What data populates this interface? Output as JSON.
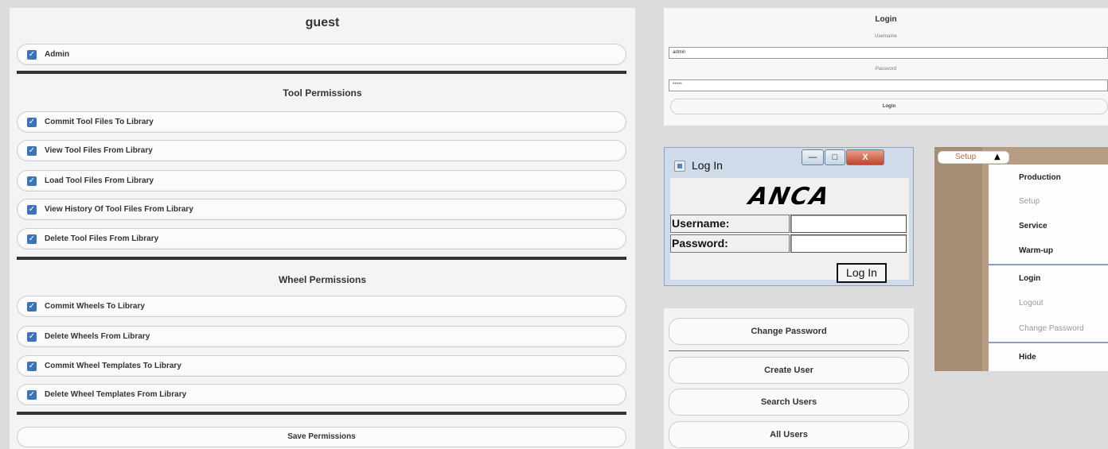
{
  "permissions": {
    "title": "guest",
    "admin_label": "Admin",
    "tool_heading": "Tool Permissions",
    "tool_items": [
      "Commit Tool Files To Library",
      "View Tool Files From Library",
      "Load Tool Files From Library",
      "View History Of Tool Files From Library",
      "Delete Tool Files From Library"
    ],
    "wheel_heading": "Wheel Permissions",
    "wheel_items": [
      "Commit Wheels To Library",
      "Delete Wheels From Library",
      "Commit Wheel Templates To Library",
      "Delete Wheel Templates From Library"
    ],
    "save_label": "Save Permissions",
    "checkbox_glyph": "✓"
  },
  "login_web": {
    "title": "Login",
    "username_label": "Username",
    "username_value": "admin",
    "password_label": "Password",
    "password_value": "*****",
    "button_label": "Login"
  },
  "login_dialog": {
    "title": "Log In",
    "logo_text": "ANCA",
    "username_label": "Username:",
    "password_label": "Password:",
    "button_label": "Log In",
    "min_glyph": "—",
    "max_glyph": "□",
    "close_glyph": "X"
  },
  "user_buttons": {
    "change_password": "Change Password",
    "create_user": "Create User",
    "search_users": "Search Users",
    "all_users": "All Users"
  },
  "menu": {
    "tab_label": "Setup",
    "tab_arrow": "▲",
    "items": {
      "production": "Production",
      "setup": "Setup",
      "service": "Service",
      "warmup": "Warm-up",
      "login": "Login",
      "logout": "Logout",
      "change_password": "Change Password",
      "hide": "Hide"
    }
  },
  "colors": {
    "checkbox": "#3b73b9",
    "tab_text": "#e2572f",
    "menu_separator": "#8a9bc8"
  }
}
